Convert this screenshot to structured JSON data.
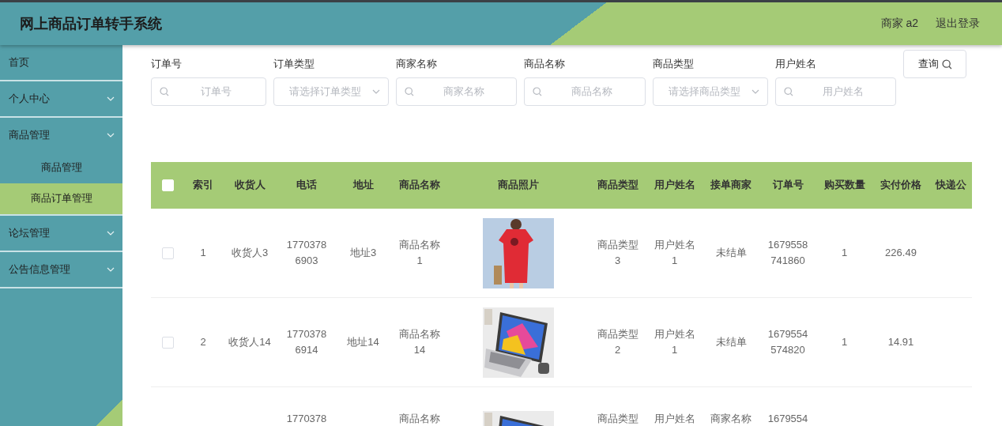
{
  "header": {
    "title": "网上商品订单转手系统",
    "user": "商家 a2",
    "logout": "退出登录"
  },
  "sidebar": {
    "items": [
      {
        "label": "首页",
        "expandable": false,
        "expanded": false,
        "selected": false
      },
      {
        "label": "个人中心",
        "expandable": true,
        "expanded": false,
        "selected": false
      },
      {
        "label": "商品管理",
        "expandable": true,
        "expanded": true,
        "selected": false,
        "children": [
          {
            "label": "商品管理",
            "selected": false
          },
          {
            "label": "商品订单管理",
            "selected": true
          }
        ]
      },
      {
        "label": "论坛管理",
        "expandable": true,
        "expanded": false,
        "selected": false
      },
      {
        "label": "公告信息管理",
        "expandable": true,
        "expanded": false,
        "selected": false
      }
    ]
  },
  "filters": [
    {
      "label": "订单号",
      "kind": "search",
      "placeholder": "订单号"
    },
    {
      "label": "订单类型",
      "kind": "select",
      "placeholder": "请选择订单类型"
    },
    {
      "label": "商家名称",
      "kind": "search",
      "placeholder": "商家名称"
    },
    {
      "label": "商品名称",
      "kind": "search",
      "placeholder": "商品名称"
    },
    {
      "label": "商品类型",
      "kind": "select",
      "placeholder": "请选择商品类型"
    },
    {
      "label": "用户姓名",
      "kind": "search",
      "placeholder": "用户姓名"
    }
  ],
  "query_button": "查询",
  "table": {
    "select_all_checked": false,
    "columns": [
      "索引",
      "收货人",
      "电话",
      "地址",
      "商品名称",
      "商品照片",
      "商品类型",
      "用户姓名",
      "接单商家",
      "订单号",
      "购买数量",
      "实付价格",
      "快递公"
    ],
    "rows": [
      {
        "checked": false,
        "index": "1",
        "receiver": "收货人3",
        "phone": "17703786903",
        "address": "地址3",
        "product_name": "商品名称1",
        "product_type": "商品类型3",
        "user_name": "用户姓名1",
        "merchant": "未结单",
        "order_no": "1679558741860",
        "quantity": "1",
        "price": "226.49"
      },
      {
        "checked": false,
        "index": "2",
        "receiver": "收货人14",
        "phone": "17703786914",
        "address": "地址14",
        "product_name": "商品名称14",
        "product_type": "商品类型2",
        "user_name": "用户姓名1",
        "merchant": "未结单",
        "order_no": "1679554574820",
        "quantity": "1",
        "price": "14.91"
      },
      {
        "partial": true,
        "phone": "1770378",
        "product_name": "商品名称",
        "product_type": "商品类型",
        "user_name": "用户姓名",
        "merchant": "商家名称",
        "order_no": "1679554"
      }
    ]
  }
}
